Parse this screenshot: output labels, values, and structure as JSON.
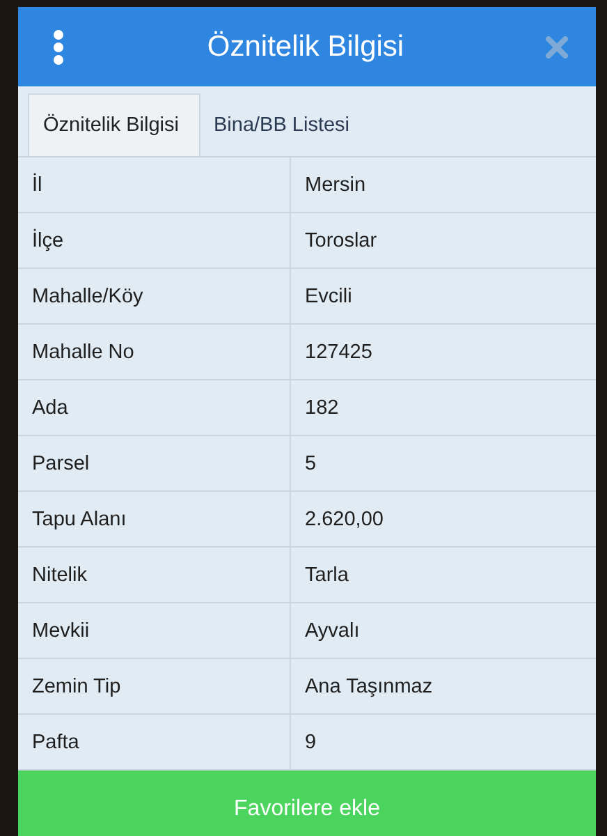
{
  "window": {
    "title": "Öznitelik Bilgisi"
  },
  "tabs": [
    {
      "label": "Öznitelik Bilgisi",
      "selected": true
    },
    {
      "label": "Bina/BB Listesi",
      "selected": false
    }
  ],
  "table": {
    "rows": [
      {
        "label": "İl",
        "value": "Mersin"
      },
      {
        "label": "İlçe",
        "value": "Toroslar"
      },
      {
        "label": "Mahalle/Köy",
        "value": "Evcili"
      },
      {
        "label": "Mahalle No",
        "value": "127425"
      },
      {
        "label": "Ada",
        "value": "182"
      },
      {
        "label": "Parsel",
        "value": "5"
      },
      {
        "label": "Tapu Alanı",
        "value": "2.620,00"
      },
      {
        "label": "Nitelik",
        "value": "Tarla"
      },
      {
        "label": "Mevkii",
        "value": "Ayvalı"
      },
      {
        "label": "Zemin Tip",
        "value": "Ana Taşınmaz"
      },
      {
        "label": "Pafta",
        "value": "9"
      }
    ]
  },
  "footer_button": "Favorilere ekle"
}
